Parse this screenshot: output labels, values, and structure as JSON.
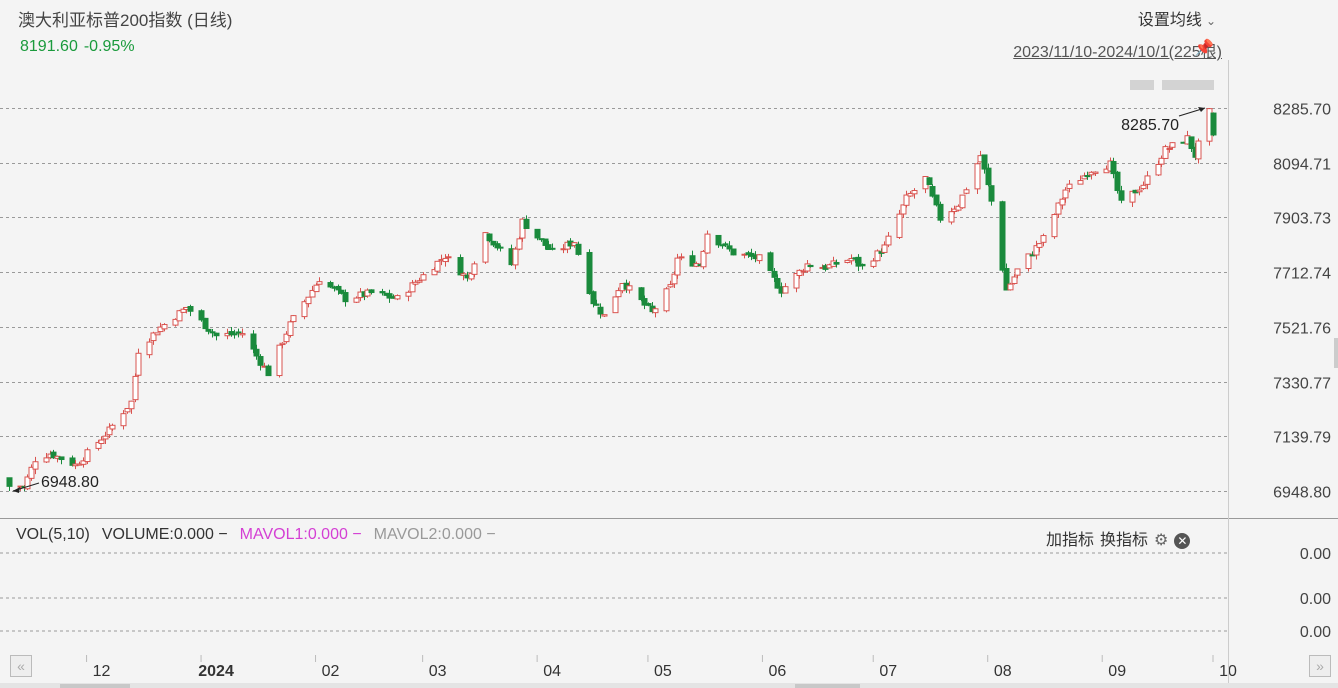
{
  "header": {
    "title": "澳大利亚标普200指数 (日线)",
    "last_price": "8191.60",
    "change_pct": "-0.95%",
    "settings_label": "设置均线",
    "range_label": "2023/11/10-2024/10/1(225根)"
  },
  "volume_panel": {
    "vol_label": "VOL(5,10)",
    "volume_label": "VOLUME:0.000 −",
    "mavol1_label": "MAVOL1:0.000 −",
    "mavol2_label": "MAVOL2:0.000 −",
    "add_indicator": "加指标",
    "switch_indicator": "换指标",
    "y_ticks": [
      "0.00",
      "0.00",
      "0.00"
    ]
  },
  "colors": {
    "up": "#d9534f",
    "down": "#1a8a3c",
    "price_text": "#1a9a3c",
    "mavol1": "#d43fd4",
    "mavol2": "#999999"
  },
  "icons": [
    "pin-icon",
    "gear-icon",
    "close-icon",
    "scroll-left-icon",
    "scroll-right-icon"
  ],
  "chart_data": {
    "type": "candlestick",
    "y_ticks": [
      "8285.70",
      "8094.71",
      "7903.73",
      "7712.74",
      "7521.76",
      "7330.77",
      "7139.79",
      "6948.80"
    ],
    "ylim": [
      6948.8,
      8285.7
    ],
    "x_labels": [
      "12",
      "2024",
      "02",
      "03",
      "04",
      "05",
      "06",
      "07",
      "08",
      "09",
      "10"
    ],
    "max_annotation": "8285.70",
    "min_annotation": "6948.80",
    "x_start": "2023-11-10",
    "x_end": "2024-10-01",
    "bar_count": 225,
    "anchors": [
      [
        "2023-11-10",
        6990
      ],
      [
        "2023-11-14",
        6960
      ],
      [
        "2023-11-17",
        7060
      ],
      [
        "2023-11-21",
        7080
      ],
      [
        "2023-11-28",
        7040
      ],
      [
        "2023-12-01",
        7080
      ],
      [
        "2023-12-07",
        7160
      ],
      [
        "2023-12-13",
        7260
      ],
      [
        "2023-12-15",
        7440
      ],
      [
        "2023-12-20",
        7510
      ],
      [
        "2023-12-28",
        7590
      ],
      [
        "2024-01-05",
        7490
      ],
      [
        "2024-01-12",
        7500
      ],
      [
        "2024-01-19",
        7360
      ],
      [
        "2024-01-25",
        7530
      ],
      [
        "2024-02-02",
        7690
      ],
      [
        "2024-02-09",
        7620
      ],
      [
        "2024-02-16",
        7640
      ],
      [
        "2024-02-23",
        7620
      ],
      [
        "2024-02-29",
        7690
      ],
      [
        "2024-03-07",
        7770
      ],
      [
        "2024-03-13",
        7690
      ],
      [
        "2024-03-18",
        7850
      ],
      [
        "2024-03-25",
        7740
      ],
      [
        "2024-03-28",
        7890
      ],
      [
        "2024-04-05",
        7780
      ],
      [
        "2024-04-11",
        7820
      ],
      [
        "2024-04-16",
        7610
      ],
      [
        "2024-04-19",
        7560
      ],
      [
        "2024-04-24",
        7680
      ],
      [
        "2024-05-02",
        7570
      ],
      [
        "2024-05-07",
        7660
      ],
      [
        "2024-05-09",
        7760
      ],
      [
        "2024-05-15",
        7740
      ],
      [
        "2024-05-17",
        7850
      ],
      [
        "2024-05-24",
        7780
      ],
      [
        "2024-05-31",
        7760
      ],
      [
        "2024-06-06",
        7650
      ],
      [
        "2024-06-13",
        7740
      ],
      [
        "2024-06-18",
        7730
      ],
      [
        "2024-06-25",
        7760
      ],
      [
        "2024-06-28",
        7730
      ],
      [
        "2024-07-04",
        7800
      ],
      [
        "2024-07-10",
        7970
      ],
      [
        "2024-07-15",
        8040
      ],
      [
        "2024-07-19",
        7900
      ],
      [
        "2024-07-24",
        7950
      ],
      [
        "2024-07-30",
        8120
      ],
      [
        "2024-08-02",
        7960
      ],
      [
        "2024-08-06",
        7650
      ],
      [
        "2024-08-09",
        7720
      ],
      [
        "2024-08-16",
        7830
      ],
      [
        "2024-08-22",
        8000
      ],
      [
        "2024-08-29",
        8070
      ],
      [
        "2024-09-03",
        8090
      ],
      [
        "2024-09-06",
        7950
      ],
      [
        "2024-09-12",
        8020
      ],
      [
        "2024-09-18",
        8140
      ],
      [
        "2024-09-24",
        8180
      ],
      [
        "2024-09-26",
        8120
      ],
      [
        "2024-09-30",
        8270
      ],
      [
        "2024-10-01",
        8191.6
      ]
    ]
  }
}
